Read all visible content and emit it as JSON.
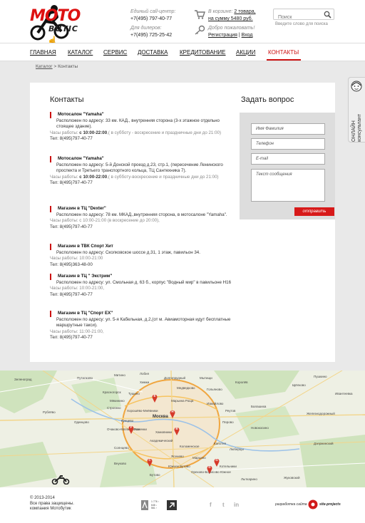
{
  "brand": {
    "word1": "MOTO",
    "word2": "BUTIC"
  },
  "header": {
    "callcenter_label": "Единый call-центр:",
    "callcenter_phone": "+7(495) 797-40-77",
    "dealers_label": "Для дилеров:",
    "dealers_phone": "+7(495) 725-25-42",
    "cart_prefix": "В корзине:",
    "cart_items": "2 товара,",
    "cart_sum": "на сумму 5480 руб.",
    "welcome": "Добро пожаловать!",
    "register": "Регистрация",
    "separator": "|",
    "login": "Вход"
  },
  "search": {
    "placeholder": "Поиск",
    "hint": "Введите слово для поиска"
  },
  "nav": {
    "items": [
      "ГЛАВНАЯ",
      "КАТАЛОГ",
      "СЕРВИС",
      "ДОСТАВКА",
      "КРЕДИТОВАНИЕ",
      "АКЦИИ",
      "КОНТАКТЫ"
    ],
    "active_index": 6
  },
  "breadcrumb": {
    "root": "Каталог",
    "separator": ">",
    "current": "Контакты"
  },
  "consultant": {
    "line1": "ОНЛАЙН",
    "line2": "консультант"
  },
  "contacts": {
    "title": "Контакты",
    "stores": [
      {
        "name": "Мотосалон \"Yamaha\"",
        "address": "Расположен по адресу: 33 км. КАД., внутренняя сторона (3-х этажное отдельно стоящее здание).",
        "hours_label": "Часы работы:",
        "hours": "с 10:00-22:00",
        "hours_note": ",( в субботу - воскресение и праздничные дни до 21:00)",
        "phone": "Тел: 8(495)797-40-77"
      },
      {
        "name": "Мотосалон \"Yamaha\"",
        "address": "Расположен по адресу: 5-й Донской проезд д.23, стр.1, (пересечение Ленинского проспекта и Третьего транспортного кольца, ТЦ Сантехника 7).",
        "hours_label": "Часы работы:",
        "hours": "с 10:00-22:00",
        "hours_note": ",( в субботу-воскресение и праздничные дни до 21:00)",
        "phone": "Тел: 8(495)797-40-77"
      },
      {
        "name": "Магазин в ТЦ \"Dexter\"",
        "address": "Расположен по адресу: 78 км. МКАД.,внутренняя сторона, в мотосалоне \"Yamaha\".",
        "hours_label": "Часы работы:",
        "hours": "",
        "hours_note": "с 10:00-21:00 (в воскресение до 20:00),",
        "phone": "Тел: 8(495)797-40-77"
      },
      {
        "name": "Магазин в ТВК Спорт Хит",
        "address": "Расположен по адресу: Сколковское шоссе д.31, 1 этаж, павильон 34.",
        "hours_label": "Часы работы:",
        "hours": "",
        "hours_note": "10:00-21:00",
        "phone": "Тел: 8(495)363-48-00"
      },
      {
        "name": "Магазин в ТЦ \" Экстрим\"",
        "address": "Расположен по адресу: ул. Смольная д. 63 б., корпус \"Водный мир\" в павильоне Н16",
        "hours_label": "Часы работы:",
        "hours": "",
        "hours_note": "10:00-21:00,",
        "phone": "Тел: 8(495)797-40-77"
      },
      {
        "name": "Магазин в ТЦ \"Спорт ЕХ\"",
        "address": "Расположен по адресу: ул. 5-я Кабельная, д.2,(от м. Авиамоторная идут бесплатные маршрутные такси).",
        "hours_label": "Часы работы:",
        "hours": "",
        "hours_note": "11:00-21:00,",
        "phone": "Тел: 8(495)797-40-77"
      }
    ]
  },
  "form": {
    "title": "Задать вопрос",
    "name_placeholder": "Имя Фамилия",
    "phone_placeholder": "Телефон",
    "email_placeholder": "E-mail",
    "message_placeholder": "Текст сообщения",
    "submit": "отправить"
  },
  "map": {
    "labels": [
      "Митино",
      "Путилково",
      "Красногорск",
      "Мякинино",
      "Строгино",
      "Хорошёво-Мнёвники",
      "Москва",
      "Измайлово",
      "Медведково",
      "Гольяново",
      "Реутов",
      "Балашиха",
      "Кунцево",
      "Очаково-Матвеевское",
      "Раменки",
      "Солнцево",
      "Внуково",
      "Южное Бутово",
      "Марьино",
      "Котельники",
      "Люберцы",
      "Жуковский",
      "Лыткарино",
      "Одинцово",
      "Химки",
      "Долгопрудный",
      "Мытищи",
      "Королёв",
      "Щёлково",
      "Дзержинский",
      "Железнодорожный",
      "Новокосино",
      "Лобня",
      "Бутово",
      "Орехово-Борисово Южное",
      "Рублёво",
      "Зеленоград",
      "Пушкино",
      "Ивантеевка",
      "Коломенское",
      "Капотня",
      "Перово",
      "Марьина Роща",
      "Тушино",
      "Хамовники",
      "Академический",
      "Ясенево"
    ],
    "pins": [
      "A",
      "B",
      "C",
      "D",
      "E",
      "F",
      "G",
      "H"
    ]
  },
  "footer": {
    "copyright": "© 2013-2014",
    "rights": "Все права защищены.",
    "company": "компания Мотобутик",
    "developed": "разработка сайта",
    "developer": "site-projects",
    "social": [
      "f",
      "t",
      "in"
    ],
    "counter": [
      "1 776 ↑",
      "646 ↓",
      "561 ↑"
    ]
  },
  "colors": {
    "accent": "#d11a1a",
    "panel": "#ffffff",
    "bg": "#e9e9e9"
  }
}
